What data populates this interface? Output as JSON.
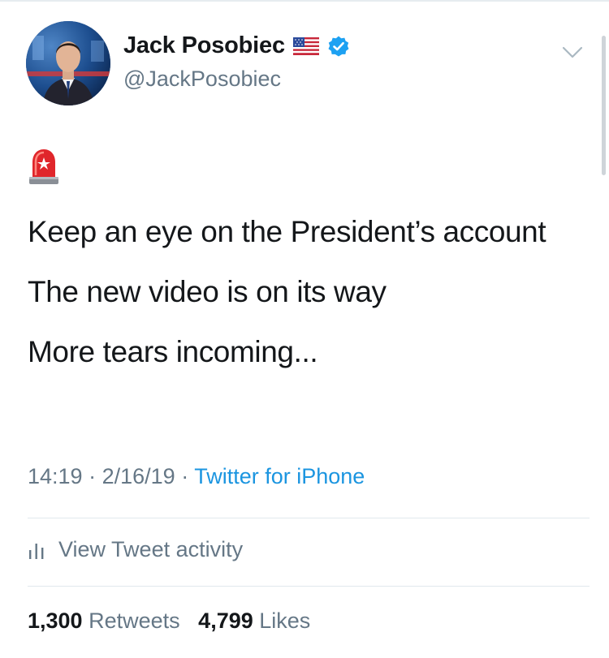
{
  "tweet": {
    "author": {
      "display_name": "Jack Posobiec",
      "handle": "@JackPosobiec",
      "flag_icon": "us-flag-icon",
      "verified_icon": "verified-badge-icon"
    },
    "emoji": "siren-icon",
    "lines": [
      "Keep an eye on the President’s account",
      "The new video is on its way",
      "More tears incoming..."
    ],
    "time": "14:19",
    "date": "2/16/19",
    "separator": "·",
    "source": "Twitter for iPhone",
    "activity_label": "View Tweet activity",
    "retweets_count": "1,300",
    "retweets_label": "Retweets",
    "likes_count": "4,799",
    "likes_label": "Likes"
  },
  "colors": {
    "text": "#14171a",
    "secondary": "#657786",
    "link": "#1b95e0",
    "verified": "#1da1f2",
    "divider": "#e1e8ed"
  }
}
